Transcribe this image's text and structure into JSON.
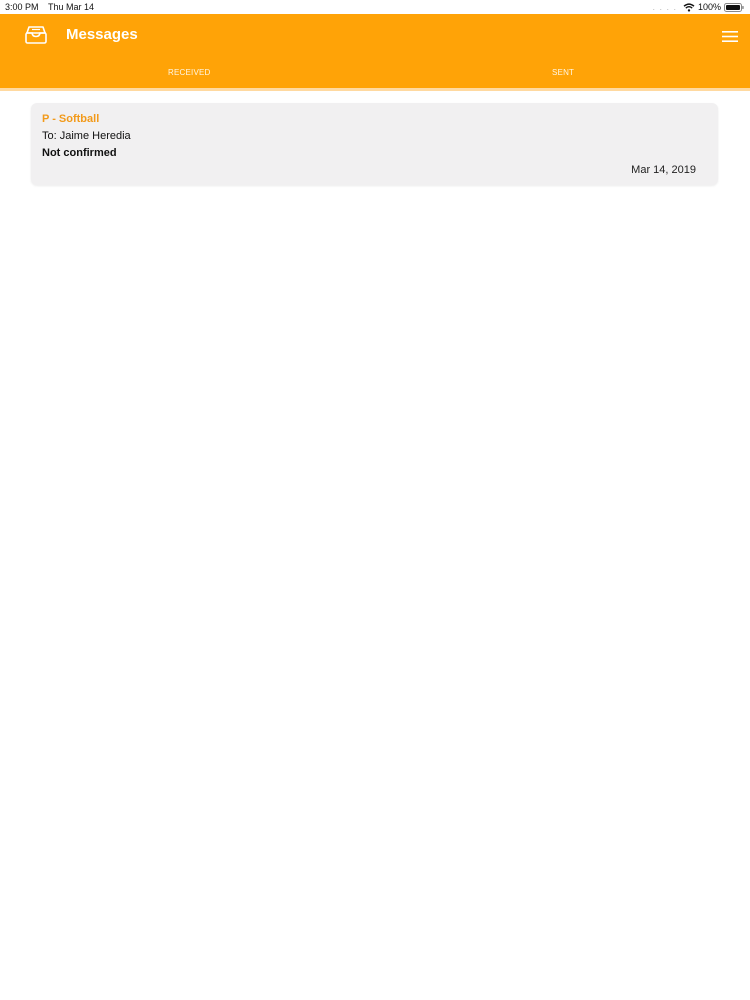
{
  "status_bar": {
    "time": "3:00 PM",
    "date": "Thu Mar 14",
    "signal_dots": ". . . .",
    "battery": "100%"
  },
  "header": {
    "title": "Messages",
    "left_icon": "inbox-icon",
    "right_icon": "menu-icon",
    "background_color": "#ffa307"
  },
  "tabs": [
    {
      "label": "RECEIVED"
    },
    {
      "label": "SENT"
    }
  ],
  "messages": [
    {
      "subject": "P - Softball",
      "recipient": "To: Jaime Heredia",
      "status": "Not confirmed",
      "date": "Mar 14, 2019"
    }
  ],
  "colors": {
    "accent": "#ffa307",
    "subject": "#f29a1a",
    "card": "#f1f0f1"
  }
}
